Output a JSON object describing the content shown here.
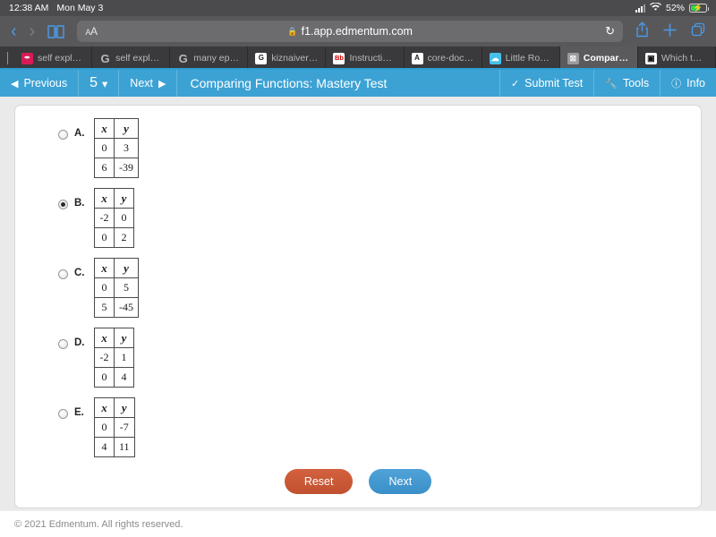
{
  "status_bar": {
    "time": "12:38 AM",
    "date": "Mon May 3",
    "battery_percent": "52%",
    "wifi_icon": "wifi-icon",
    "signal_icon": "cellular-signal-icon",
    "battery_icon": "battery-charging-icon"
  },
  "browser": {
    "back_icon": "chevron-left-icon",
    "forward_icon": "chevron-right-icon",
    "bookmarks_icon": "book-icon",
    "text_size_label": "AA",
    "url": "f1.app.edmentum.com",
    "lock_icon": "lock-icon",
    "reload_icon": "reload-icon",
    "share_icon": "share-icon",
    "new_tab_icon": "plus-icon",
    "tabs_icon": "tab-overview-icon"
  },
  "tabs": [
    {
      "label": "self expla...",
      "favicon": "pen-icon",
      "favicon_class": "fav-pen",
      "glyph": "✒",
      "active": false
    },
    {
      "label": "self expla...",
      "favicon": "google-icon",
      "favicon_class": "fav-g",
      "glyph": "G",
      "active": false
    },
    {
      "label": "many episod...",
      "favicon": "google-icon",
      "favicon_class": "fav-g",
      "glyph": "G",
      "active": false
    },
    {
      "label": "kiznaiver kat...",
      "favicon": "google-docs-icon",
      "favicon_class": "fav-box",
      "glyph": "G",
      "active": false
    },
    {
      "label": "Instructional...",
      "favicon": "blackboard-icon",
      "favicon_class": "fav-bb",
      "glyph": "Bb",
      "active": false
    },
    {
      "label": "core-docs.s...",
      "favicon": "generic-a-icon",
      "favicon_class": "fav-box",
      "glyph": "A",
      "active": false
    },
    {
      "label": "Little Rock SD",
      "favicon": "cloud-icon",
      "favicon_class": "fav-cloud",
      "glyph": "☁",
      "active": false
    },
    {
      "label": "Comparing F...",
      "favicon": "edmentum-icon",
      "favicon_class": "fav-x",
      "glyph": "⊠",
      "active": true
    },
    {
      "label": "Which two t...",
      "favicon": "video-icon",
      "favicon_class": "fav-play",
      "glyph": "▣",
      "active": false
    }
  ],
  "app_bar": {
    "previous_label": "Previous",
    "previous_icon": "arrow-left-circle-icon",
    "page_number": "5",
    "page_dropdown_icon": "chevron-down-icon",
    "next_label": "Next",
    "next_icon": "arrow-right-circle-icon",
    "title": "Comparing Functions: Mastery Test",
    "submit_label": "Submit Test",
    "submit_icon": "check-circle-icon",
    "tools_label": "Tools",
    "tools_icon": "wrench-icon",
    "info_label": "Info",
    "info_icon": "info-circle-icon",
    "accent_color": "#3ca2d4"
  },
  "question": {
    "columns": [
      "x",
      "y"
    ],
    "choices": [
      {
        "letter": "A.",
        "selected": false,
        "rows": [
          [
            "0",
            "3"
          ],
          [
            "6",
            "-39"
          ]
        ]
      },
      {
        "letter": "B.",
        "selected": true,
        "rows": [
          [
            "-2",
            "0"
          ],
          [
            "0",
            "2"
          ]
        ]
      },
      {
        "letter": "C.",
        "selected": false,
        "rows": [
          [
            "0",
            "5"
          ],
          [
            "5",
            "-45"
          ]
        ]
      },
      {
        "letter": "D.",
        "selected": false,
        "rows": [
          [
            "-2",
            "1"
          ],
          [
            "0",
            "4"
          ]
        ]
      },
      {
        "letter": "E.",
        "selected": false,
        "rows": [
          [
            "0",
            "-7"
          ],
          [
            "4",
            "11"
          ]
        ]
      }
    ],
    "reset_label": "Reset",
    "next_label": "Next",
    "reset_color": "#c8542f",
    "next_color": "#3f92cc"
  },
  "footer": {
    "copyright": "© 2021 Edmentum. All rights reserved."
  }
}
